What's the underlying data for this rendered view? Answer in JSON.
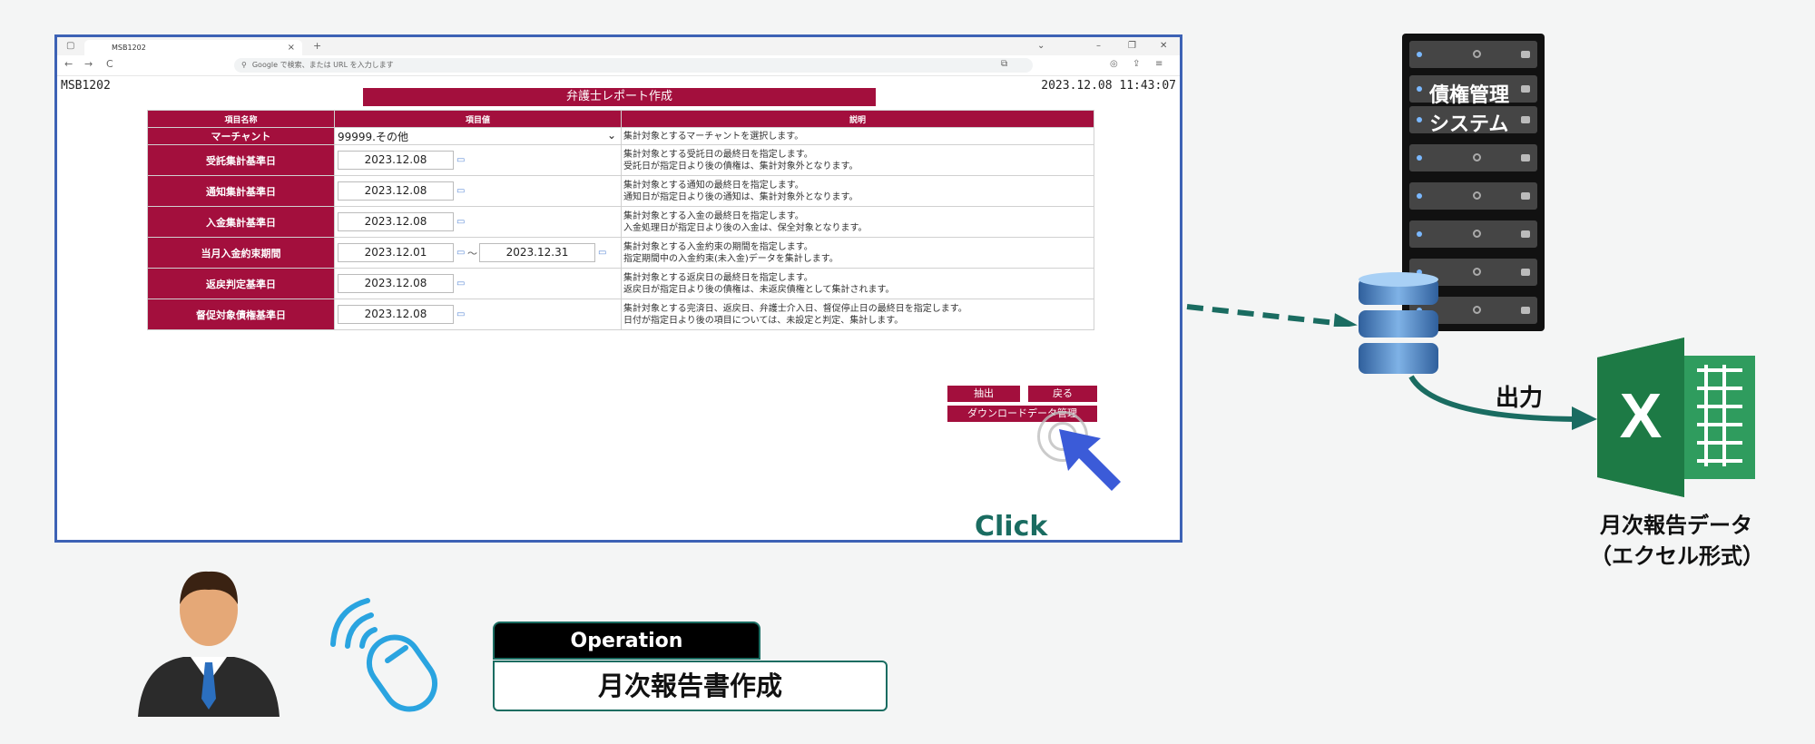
{
  "browser": {
    "tab_title": "MSB1202",
    "tab_close": "×",
    "new_tab": "+",
    "address_placeholder": "Google で検索、または URL を入力します",
    "nav": {
      "back": "←",
      "forward": "→",
      "reload": "C"
    }
  },
  "page": {
    "system_id": "MSB1202",
    "timestamp": "2023.12.08 11:43:07",
    "form_title": "弁護士レポート作成",
    "columns": [
      "項目名称",
      "項目値",
      "説明"
    ],
    "rows": [
      {
        "label": "マーチャント",
        "value": "99999.その他",
        "type": "select",
        "desc": "集計対象とするマーチャントを選択します。"
      },
      {
        "label": "受託集計基準日",
        "value": "2023.12.08",
        "type": "date",
        "desc": "集計対象とする受託日の最終日を指定します。\n受託日が指定日より後の債権は、集計対象外となります。"
      },
      {
        "label": "通知集計基準日",
        "value": "2023.12.08",
        "type": "date",
        "desc": "集計対象とする通知の最終日を指定します。\n通知日が指定日より後の通知は、集計対象外となります。"
      },
      {
        "label": "入金集計基準日",
        "value": "2023.12.08",
        "type": "date",
        "desc": "集計対象とする入金の最終日を指定します。\n入金処理日が指定日より後の入金は、保全対象となります。"
      },
      {
        "label": "当月入金約束期間",
        "value": "2023.12.01",
        "value2": "2023.12.31",
        "type": "range",
        "desc": "集計対象とする入金約束の期間を指定します。\n指定期間中の入金約束(未入金)データを集計します。"
      },
      {
        "label": "返戻判定基準日",
        "value": "2023.12.08",
        "type": "date",
        "desc": "集計対象とする返戻日の最終日を指定します。\n返戻日が指定日より後の債権は、未返戻債権として集計されます。"
      },
      {
        "label": "督促対象債権基準日",
        "value": "2023.12.08",
        "type": "date",
        "desc": "集計対象とする完済日、返戻日、弁護士介入日、督促停止日の最終日を指定します。\n日付が指定日より後の項目については、未設定と判定、集計します。"
      }
    ],
    "buttons": {
      "extract": "抽出",
      "back": "戻る",
      "download": "ダウンロードデータ管理"
    }
  },
  "annotations": {
    "click": "Click",
    "server_label_1": "債権管理",
    "server_label_2": "システム",
    "output_label": "出力",
    "excel_label_1": "月次報告データ",
    "excel_label_2": "（エクセル形式）",
    "operation_tab": "Operation",
    "operation_name": "月次報告書作成"
  },
  "colors": {
    "form_accent": "#a30f3d",
    "teal": "#1a6c61",
    "browser_border": "#3d62b5",
    "excel_green": "#1d7a45",
    "cursor_blue": "#3b5bd8"
  },
  "icons": {
    "calendar": "calendar-icon",
    "excel": "excel-icon",
    "database": "database-icon",
    "server": "server-rack-icon",
    "user": "user-avatar-icon",
    "mouse": "mouse-click-icon"
  }
}
